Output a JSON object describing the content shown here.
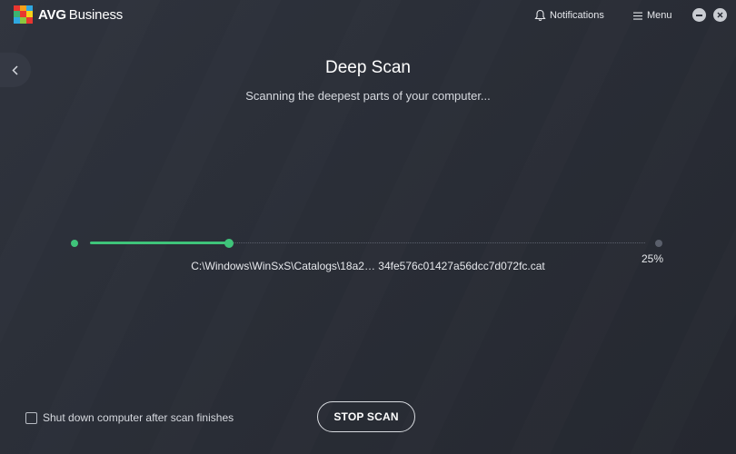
{
  "app": {
    "brand": "AVG",
    "product": "Business"
  },
  "header": {
    "notifications_label": "Notifications",
    "menu_label": "Menu"
  },
  "scan": {
    "title": "Deep Scan",
    "subtitle": "Scanning the deepest parts of your computer...",
    "current_file": "C:\\Windows\\WinSxS\\Catalogs\\18a2… 34fe576c01427a56dcc7d072fc.cat",
    "progress_percent": 25,
    "progress_label": "25%"
  },
  "footer": {
    "shutdown_checkbox_label": "Shut down computer after scan finishes",
    "shutdown_checked": false,
    "stop_button_label": "STOP SCAN"
  },
  "colors": {
    "accent": "#3fc47a",
    "background": "#2a2e37"
  }
}
